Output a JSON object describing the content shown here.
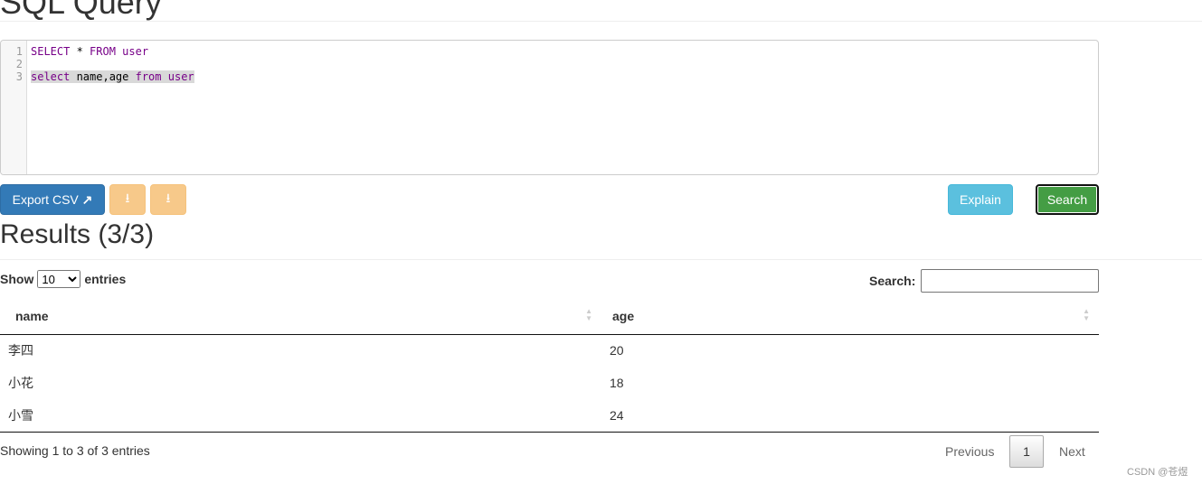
{
  "header": {
    "title": "SQL Query"
  },
  "editor": {
    "line_numbers": [
      "1",
      "2",
      "3"
    ],
    "line1": {
      "kw1": "SELECT",
      "mid": " * ",
      "kw2": "FROM",
      "rest": " user"
    },
    "line3": {
      "kw1": "select",
      "mid": " name,age ",
      "kw2": "from",
      "rest": " user"
    }
  },
  "toolbar": {
    "export_label": "Export CSV",
    "export_icon": "share-square-icon",
    "download_icon": "download-icon",
    "download_all_icon": "download-all-icon",
    "explain_label": "Explain",
    "search_label": "Search"
  },
  "results": {
    "title": "Results (3/3)",
    "show_label": "Show",
    "entries_label": "entries",
    "page_length": "10",
    "search_label": "Search:",
    "search_value": "",
    "columns": [
      "name",
      "age"
    ],
    "rows": [
      [
        "李四",
        "20"
      ],
      [
        "小花",
        "18"
      ],
      [
        "小雪",
        "24"
      ]
    ],
    "info": "Showing 1 to 3 of 3 entries",
    "previous": "Previous",
    "page": "1",
    "next": "Next"
  },
  "watermark": "CSDN @苍煜"
}
